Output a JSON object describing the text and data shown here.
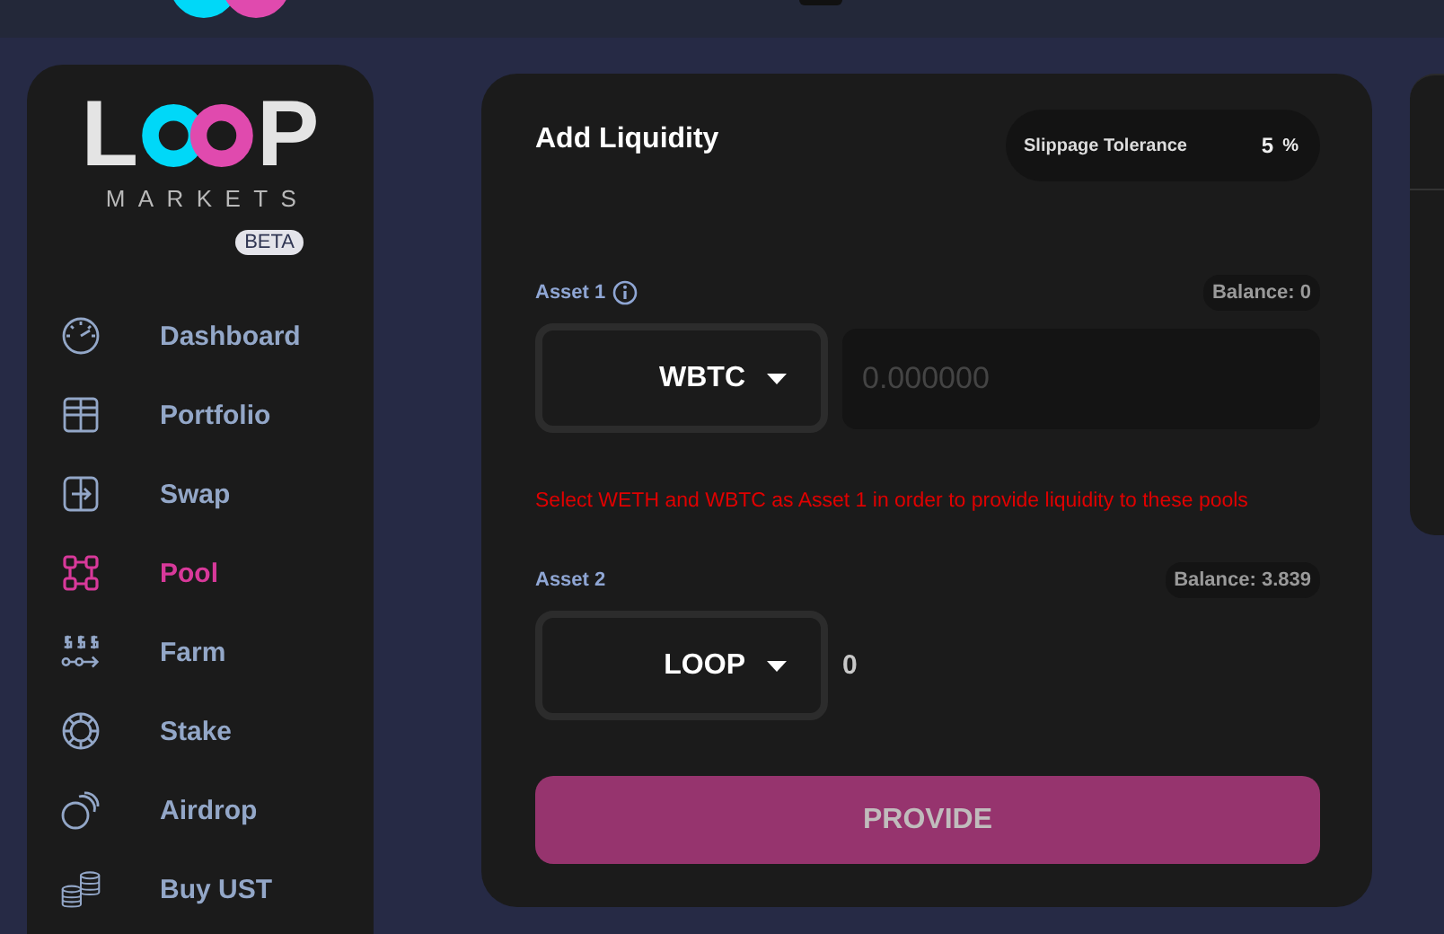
{
  "sidebar": {
    "logo": {
      "left": "L",
      "right": "P",
      "subtitle": "MARKETS",
      "badge": "BETA"
    },
    "nav": [
      {
        "label": "Dashboard",
        "selected": false
      },
      {
        "label": "Portfolio",
        "selected": false
      },
      {
        "label": "Swap",
        "selected": false
      },
      {
        "label": "Pool",
        "selected": true
      },
      {
        "label": "Farm",
        "selected": false
      },
      {
        "label": "Stake",
        "selected": false
      },
      {
        "label": "Airdrop",
        "selected": false
      },
      {
        "label": "Buy UST",
        "selected": false
      }
    ]
  },
  "card": {
    "title": "Add Liquidity",
    "slippage": {
      "label": "Slippage Tolerance",
      "value": "5",
      "unit": "%"
    },
    "assets": [
      {
        "label": "Asset 1",
        "info": true,
        "balance": "Balance: 0",
        "token": "WBTC",
        "amount": {
          "kind": "input",
          "placeholder": "0.000000"
        }
      },
      {
        "label": "Asset 2",
        "info": false,
        "balance": "Balance: 3.839",
        "token": "LOOP",
        "amount": {
          "kind": "text",
          "value": "0"
        }
      }
    ],
    "notice": "Select WETH and WBTC as Asset 1 in order to provide liquidity to these pools",
    "button": {
      "label": "PROVIDE",
      "disabled": true
    }
  }
}
